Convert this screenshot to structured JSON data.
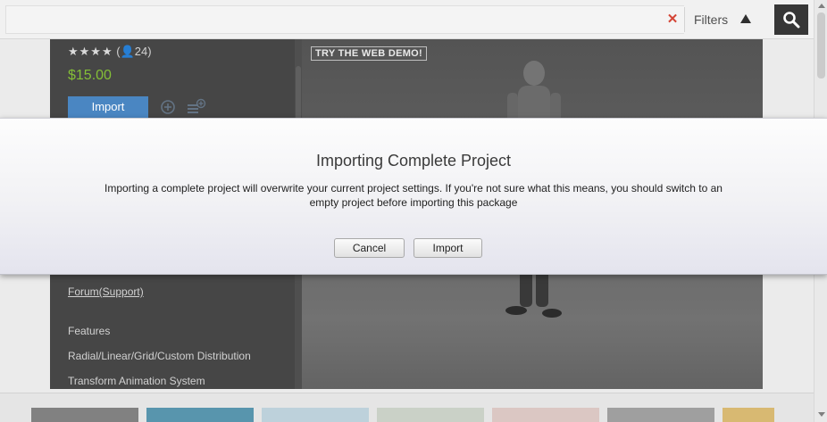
{
  "search": {
    "clear_icon": "close-icon",
    "filters_label": "Filters",
    "filters_icon": "triangle-up-icon",
    "search_icon": "magnifier-icon"
  },
  "package": {
    "stars": "★★★★",
    "rating_count": "(👤24)",
    "price": "$15.00",
    "import_label": "Import",
    "forum_link": "Forum(Support)",
    "features_heading": "Features",
    "features": [
      "Radial/Linear/Grid/Custom Distribution",
      "Transform Animation System"
    ]
  },
  "preview": {
    "demo_badge": "TRY THE WEB DEMO!"
  },
  "dialog": {
    "title": "Importing Complete Project",
    "message": "Importing a complete project will overwrite your current project settings. If you're not sure what this means, you should switch to an empty project before importing this package",
    "cancel_label": "Cancel",
    "import_label": "Import"
  },
  "colors": {
    "price_green": "#7dbb2b",
    "import_blue": "#3f7fbf",
    "clear_red": "#d23a2a",
    "panel_dark": "#3b3b3b"
  }
}
